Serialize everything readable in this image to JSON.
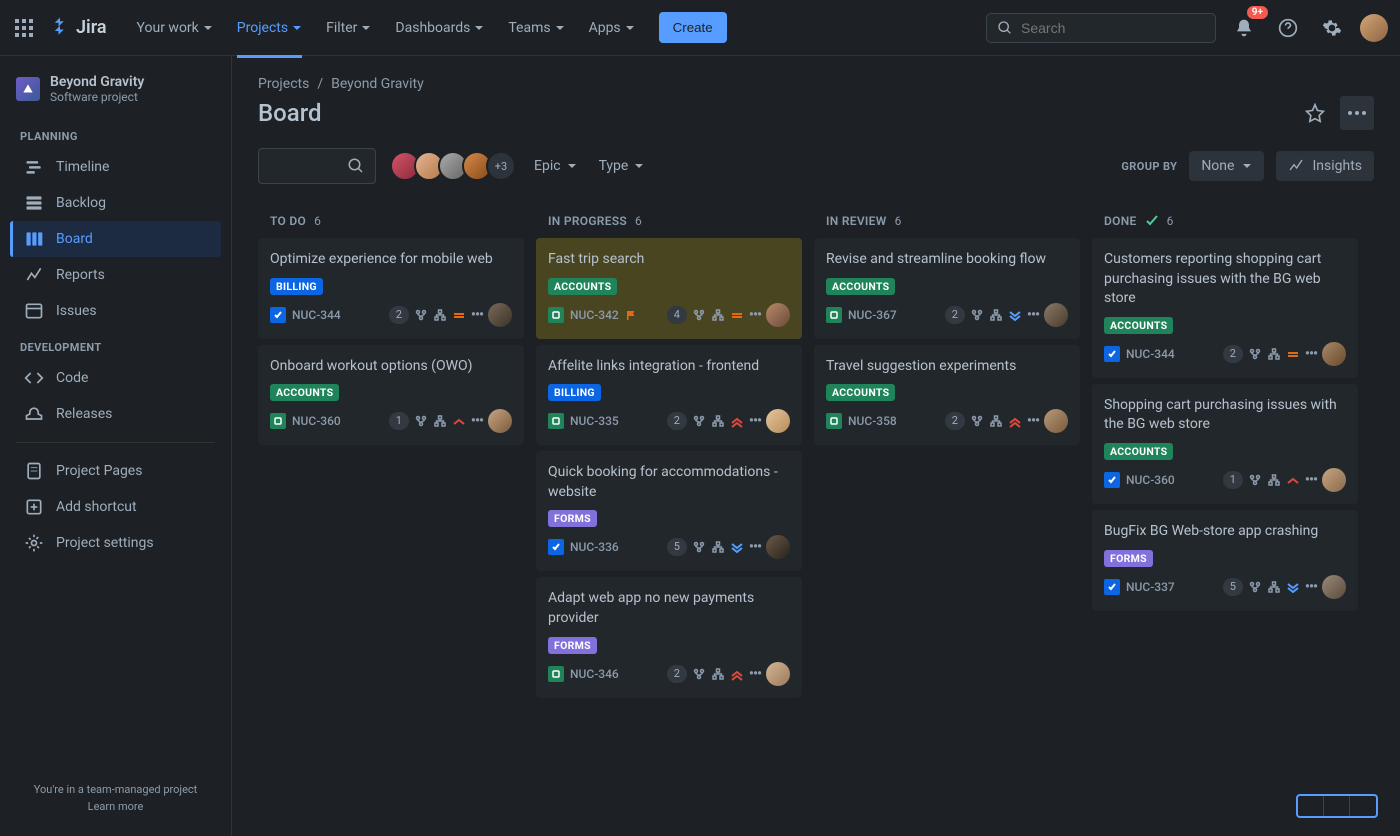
{
  "topnav": {
    "logo_text": "Jira",
    "items": [
      {
        "label": "Your work"
      },
      {
        "label": "Projects",
        "active": true
      },
      {
        "label": "Filter"
      },
      {
        "label": "Dashboards"
      },
      {
        "label": "Teams"
      },
      {
        "label": "Apps"
      }
    ],
    "create": "Create",
    "search_placeholder": "Search",
    "notif_badge": "9+"
  },
  "project": {
    "name": "Beyond Gravity",
    "type": "Software project"
  },
  "sidebar": {
    "groups": [
      {
        "label": "PLANNING",
        "items": [
          {
            "label": "Timeline",
            "icon": "timeline"
          },
          {
            "label": "Backlog",
            "icon": "backlog"
          },
          {
            "label": "Board",
            "icon": "board",
            "selected": true
          },
          {
            "label": "Reports",
            "icon": "reports"
          },
          {
            "label": "Issues",
            "icon": "issues"
          }
        ]
      },
      {
        "label": "DEVELOPMENT",
        "items": [
          {
            "label": "Code",
            "icon": "code"
          },
          {
            "label": "Releases",
            "icon": "releases"
          }
        ]
      }
    ],
    "footer_items": [
      {
        "label": "Project Pages",
        "icon": "page"
      },
      {
        "label": "Add shortcut",
        "icon": "plus-box"
      },
      {
        "label": "Project settings",
        "icon": "gear"
      }
    ],
    "footer_text": "You're in a team-managed project",
    "footer_link": "Learn more"
  },
  "breadcrumb": [
    "Projects",
    "Beyond Gravity"
  ],
  "page_title": "Board",
  "controls": {
    "avatars_more": "+3",
    "epic": "Epic",
    "type": "Type",
    "groupby_label": "GROUP BY",
    "groupby_value": "None",
    "insights": "Insights"
  },
  "columns": [
    {
      "id": "todo",
      "title": "TO DO",
      "count": "6",
      "cards": [
        {
          "title": "Optimize experience for mobile web",
          "tag": "BILLING",
          "tag_cls": "tag-billing",
          "type": "task",
          "key": "NUC-344",
          "est": "2",
          "prio": "medium",
          "avatar": "a1"
        },
        {
          "title": "Onboard workout options (OWO)",
          "tag": "ACCOUNTS",
          "tag_cls": "tag-accounts",
          "type": "story",
          "key": "NUC-360",
          "est": "1",
          "prio": "high-1",
          "avatar": "a2"
        }
      ]
    },
    {
      "id": "inprogress",
      "title": "IN PROGRESS",
      "count": "6",
      "cards": [
        {
          "title": "Fast trip search",
          "tag": "ACCOUNTS",
          "tag_cls": "tag-accounts",
          "type": "story",
          "key": "NUC-342",
          "flag": true,
          "est": "4",
          "prio": "medium",
          "avatar": "a3",
          "highlight": true
        },
        {
          "title": "Affelite links integration - frontend",
          "tag": "BILLING",
          "tag_cls": "tag-billing",
          "type": "story",
          "key": "NUC-335",
          "est": "2",
          "prio": "highest",
          "avatar": "a4"
        },
        {
          "title": "Quick booking for accommodations - website",
          "tag": "FORMS",
          "tag_cls": "tag-forms",
          "type": "task",
          "key": "NUC-336",
          "est": "5",
          "prio": "low",
          "avatar": "a5"
        },
        {
          "title": "Adapt web app no new payments provider",
          "tag": "FORMS",
          "tag_cls": "tag-forms",
          "type": "story",
          "key": "NUC-346",
          "est": "2",
          "prio": "highest",
          "avatar": "a6"
        }
      ]
    },
    {
      "id": "inreview",
      "title": "IN REVIEW",
      "count": "6",
      "cards": [
        {
          "title": "Revise and streamline booking flow",
          "tag": "ACCOUNTS",
          "tag_cls": "tag-accounts",
          "type": "story",
          "key": "NUC-367",
          "est": "2",
          "prio": "low",
          "avatar": "a7"
        },
        {
          "title": "Travel suggestion experiments",
          "tag": "ACCOUNTS",
          "tag_cls": "tag-accounts",
          "type": "story",
          "key": "NUC-358",
          "est": "2",
          "prio": "highest",
          "avatar": "a8"
        }
      ]
    },
    {
      "id": "done",
      "title": "DONE",
      "count": "6",
      "done": true,
      "cards": [
        {
          "title": "Customers reporting shopping cart purchasing issues with the BG web store",
          "tag": "ACCOUNTS",
          "tag_cls": "tag-accounts",
          "type": "task",
          "key": "NUC-344",
          "est": "2",
          "prio": "medium",
          "avatar": "a9"
        },
        {
          "title": "Shopping cart purchasing issues with the BG web store",
          "tag": "ACCOUNTS",
          "tag_cls": "tag-accounts",
          "type": "task",
          "key": "NUC-360",
          "est": "1",
          "prio": "high-1",
          "avatar": "a10"
        },
        {
          "title": "BugFix BG Web-store app crashing",
          "tag": "FORMS",
          "tag_cls": "tag-forms",
          "type": "task",
          "key": "NUC-337",
          "est": "5",
          "prio": "low",
          "avatar": "a11"
        }
      ]
    }
  ],
  "avatar_colors": {
    "a1": "linear-gradient(135deg,#7a6a5a,#3a3228)",
    "a2": "linear-gradient(135deg,#c9a584,#7a5a3a)",
    "a3": "linear-gradient(135deg,#b88a6a,#6a4a3a)",
    "a4": "linear-gradient(135deg,#e5c79a,#b88a5a)",
    "a5": "linear-gradient(135deg,#6a5a4a,#2a2218)",
    "a6": "linear-gradient(135deg,#d5b594,#9a7a5a)",
    "a7": "linear-gradient(135deg,#8a7a6a,#4a3a2a)",
    "a8": "linear-gradient(135deg,#b59a7a,#7a5a3a)",
    "a9": "linear-gradient(135deg,#a58a6a,#6a4a2a)",
    "a10": "linear-gradient(135deg,#c5a584,#8a6a4a)",
    "a11": "linear-gradient(135deg,#9a8a7a,#5a4a3a)"
  },
  "stack_avatars": [
    "linear-gradient(135deg,#d4546a,#8a2a3a)",
    "linear-gradient(135deg,#e5b594,#b57a4a)",
    "linear-gradient(135deg,#aaa,#666)",
    "linear-gradient(135deg,#d58a4a,#8a4a1a)"
  ]
}
